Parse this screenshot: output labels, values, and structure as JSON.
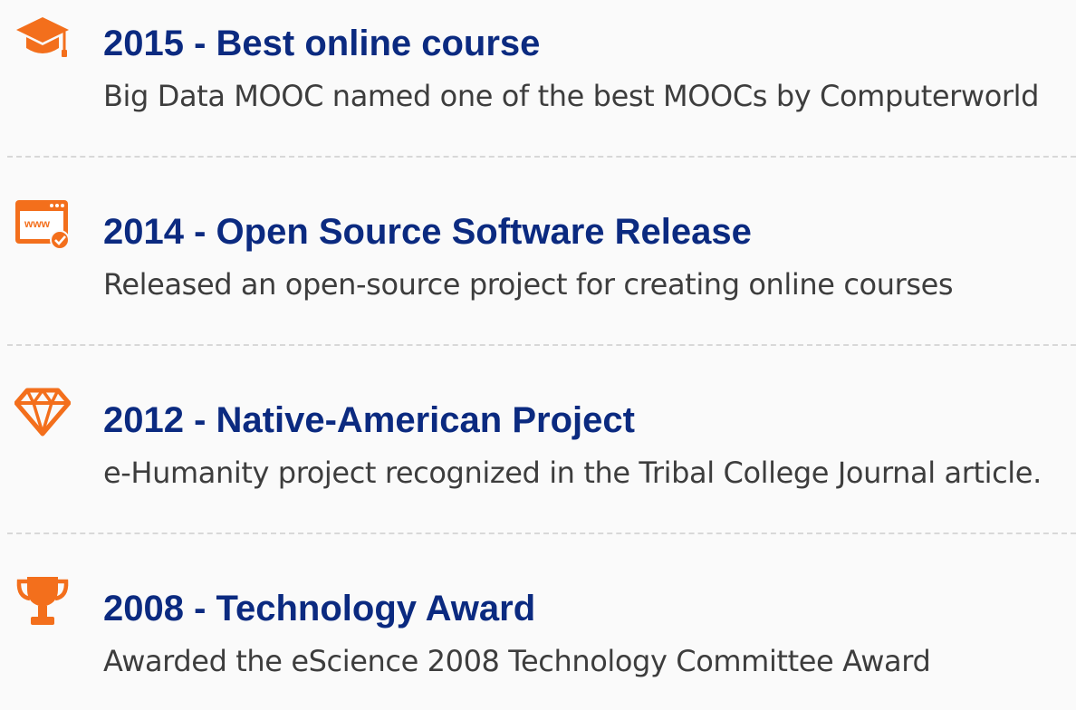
{
  "accent_color": "#f36f1c",
  "title_color": "#0b2a80",
  "text_color": "#3d3d3d",
  "achievements": [
    {
      "icon": "graduation-cap-icon",
      "title": "2015 - Best online course",
      "description": "Big Data MOOC named one of the best MOOCs by Computerworld"
    },
    {
      "icon": "web-browser-check-icon",
      "title": "2014 - Open Source Software Release",
      "description": "Released an open-source project for creating online courses",
      "icon_text": "www"
    },
    {
      "icon": "diamond-icon",
      "title": "2012 - Native-American Project",
      "description": "e-Humanity project recognized in the Tribal College Journal article."
    },
    {
      "icon": "trophy-icon",
      "title": "2008 - Technology Award",
      "description": "Awarded the eScience 2008 Technology Committee Award"
    }
  ]
}
